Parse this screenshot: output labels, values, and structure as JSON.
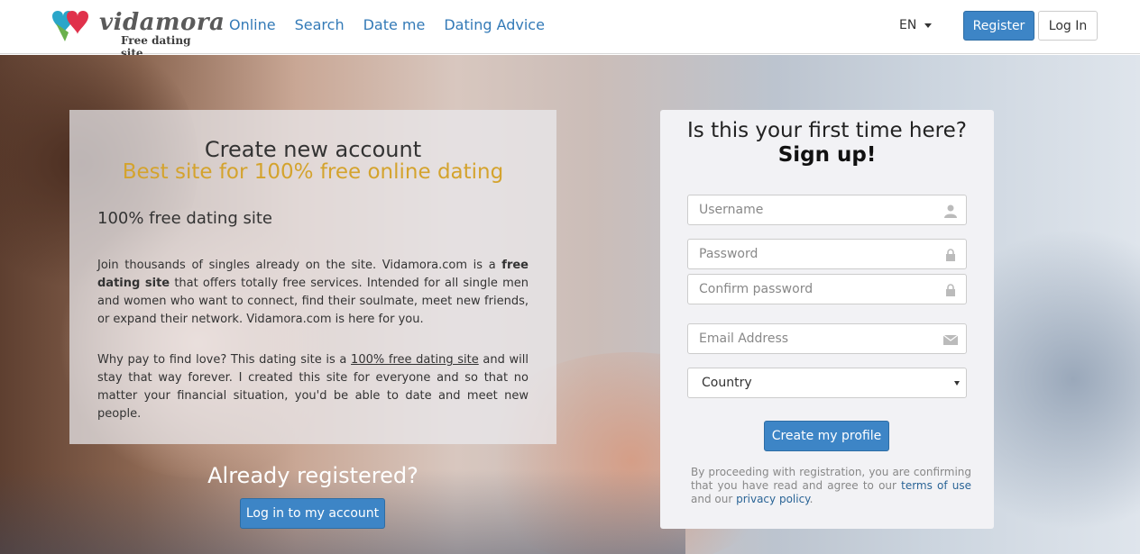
{
  "header": {
    "logo_name": "vidamora",
    "logo_tagline": "Free dating site",
    "nav": [
      "Online",
      "Search",
      "Date me",
      "Dating Advice"
    ],
    "language": "EN",
    "register_label": "Register",
    "login_label": "Log In"
  },
  "info": {
    "title": "Create new account",
    "subtitle": "Best site for 100% free online dating",
    "heading": "100% free dating site",
    "p1_a": "Join thousands of singles already on the site. Vidamora.com is a ",
    "p1_b": "free dating site",
    "p1_c": " that offers totally free services. Intended for all single men and women who want to connect, find their soulmate, meet new friends, or expand their network. Vidamora.com is here for you.",
    "p2_a": "Why pay to find love? This dating site is a ",
    "p2_b": "100% free dating site",
    "p2_c": " and will stay that way forever. I created this site for everyone and so that no matter your financial situation, you'd be able to date and meet new people.",
    "subtitle_color": "#d4a32d"
  },
  "already": {
    "title": "Already registered?",
    "button": "Log in to my account"
  },
  "signup": {
    "question": "Is this your first time here?",
    "cta": "Sign up!",
    "username_placeholder": "Username",
    "password_placeholder": "Password",
    "confirm_placeholder": "Confirm password",
    "email_placeholder": "Email Address",
    "country_value": "Country",
    "create_button": "Create my profile",
    "legal_a": "By proceeding with registration, you are confirming that you have read and agree to our ",
    "legal_terms": "terms of use",
    "legal_b": " and our ",
    "legal_privacy": "privacy policy",
    "legal_c": "."
  },
  "colors": {
    "accent": "#3d85c6",
    "link": "#337ab7"
  },
  "icons": {
    "username": "user-icon",
    "password": "lock-icon",
    "confirm": "lock-icon",
    "email": "envelope-icon",
    "country": "caret-down-icon"
  }
}
